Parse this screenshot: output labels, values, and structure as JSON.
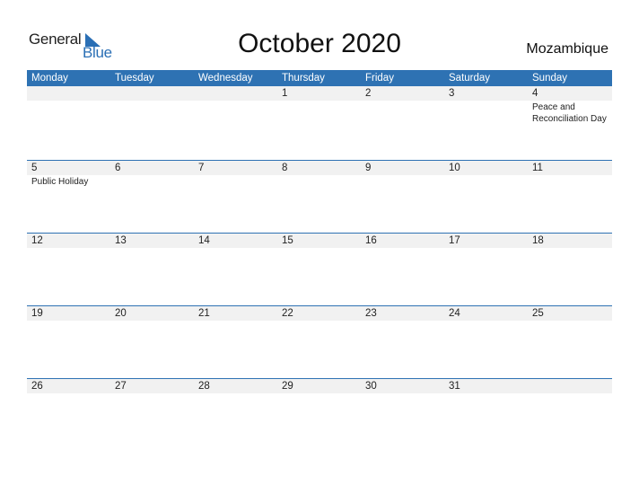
{
  "logo": {
    "general": "General",
    "blue": "Blue"
  },
  "title": "October 2020",
  "country": "Mozambique",
  "colors": {
    "accent": "#2e72b3",
    "strip": "#f1f1f1"
  },
  "weekdays": [
    "Monday",
    "Tuesday",
    "Wednesday",
    "Thursday",
    "Friday",
    "Saturday",
    "Sunday"
  ],
  "weeks": [
    {
      "days": [
        {
          "num": "",
          "event": ""
        },
        {
          "num": "",
          "event": ""
        },
        {
          "num": "",
          "event": ""
        },
        {
          "num": "1",
          "event": ""
        },
        {
          "num": "2",
          "event": ""
        },
        {
          "num": "3",
          "event": ""
        },
        {
          "num": "4",
          "event": "Peace and Reconciliation Day"
        }
      ]
    },
    {
      "days": [
        {
          "num": "5",
          "event": "Public Holiday"
        },
        {
          "num": "6",
          "event": ""
        },
        {
          "num": "7",
          "event": ""
        },
        {
          "num": "8",
          "event": ""
        },
        {
          "num": "9",
          "event": ""
        },
        {
          "num": "10",
          "event": ""
        },
        {
          "num": "11",
          "event": ""
        }
      ]
    },
    {
      "days": [
        {
          "num": "12",
          "event": ""
        },
        {
          "num": "13",
          "event": ""
        },
        {
          "num": "14",
          "event": ""
        },
        {
          "num": "15",
          "event": ""
        },
        {
          "num": "16",
          "event": ""
        },
        {
          "num": "17",
          "event": ""
        },
        {
          "num": "18",
          "event": ""
        }
      ]
    },
    {
      "days": [
        {
          "num": "19",
          "event": ""
        },
        {
          "num": "20",
          "event": ""
        },
        {
          "num": "21",
          "event": ""
        },
        {
          "num": "22",
          "event": ""
        },
        {
          "num": "23",
          "event": ""
        },
        {
          "num": "24",
          "event": ""
        },
        {
          "num": "25",
          "event": ""
        }
      ]
    },
    {
      "days": [
        {
          "num": "26",
          "event": ""
        },
        {
          "num": "27",
          "event": ""
        },
        {
          "num": "28",
          "event": ""
        },
        {
          "num": "29",
          "event": ""
        },
        {
          "num": "30",
          "event": ""
        },
        {
          "num": "31",
          "event": ""
        },
        {
          "num": "",
          "event": ""
        }
      ]
    }
  ]
}
